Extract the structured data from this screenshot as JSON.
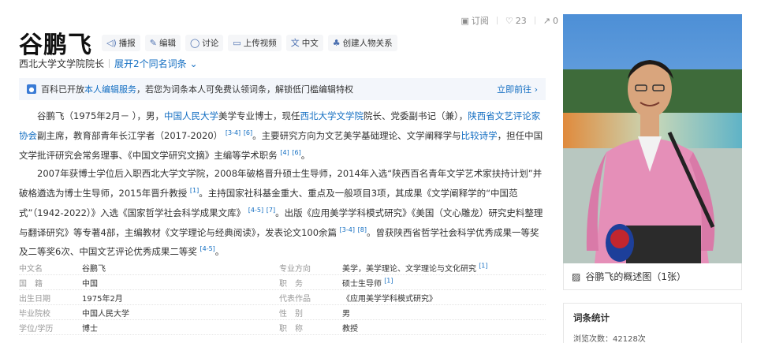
{
  "top_actions": {
    "subscribe": "订阅",
    "likes": "23",
    "shares": "0"
  },
  "title": "谷鹏飞",
  "tools": [
    "播报",
    "编辑",
    "讨论",
    "上传视频",
    "中文",
    "创建人物关系"
  ],
  "subtitle": {
    "desc": "西北大学文学院院长",
    "expand": "展开2个同名词条"
  },
  "notice": {
    "prefix": "百科已开放",
    "link": "本人编辑服务",
    "suffix": "，若您为词条本人可免费认领词条，解锁低门槛编辑特权",
    "go": "立即前往"
  },
  "para1": {
    "s1": "谷鹏飞（1975年2月－ ），男，",
    "l1": "中国人民大学",
    "s2": "美学专业博士，现任",
    "l2": "西北大学文学院",
    "s3": "院长、党委副书记（兼），",
    "l3": "陕西省文艺评论家协会",
    "s4": "副主席，教育部青年长江学者（2017-2020）",
    "r1": "[3-4]",
    "r2": "[6]",
    "s5": "。主要研究方向为文艺美学基础理论、文学阐释学与",
    "l4": "比较诗学",
    "s6": "，担任中国文学批评研究会常务理事、《中国文学研究文摘》主编等学术职务",
    "r3": "[4]",
    "r4": "[6]",
    "s7": "。"
  },
  "para2": {
    "s1": "2007年获博士学位后入职西北大学文学院，2008年破格晋升硕士生导师，2014年入选“陕西百名青年文学艺术家扶持计划”并破格遴选为博士生导师，2015年晋升教授",
    "r1": "[1]",
    "s2": "。主持国家社科基金重大、重点及一般项目3项，其成果《文学阐释学的“中国范式”（1942-2022）》入选《国家哲学社会科学成果文库》",
    "r2": "[4-5]",
    "r3": "[7]",
    "s3": "。出版《应用美学学科模式研究》《美国（文心雕龙）研究史料整理与翻译研究》等专著4部，主编教材《文学理论与经典阅读》，发表论文100余篇",
    "r4": "[3-4]",
    "r5": "[8]",
    "s4": "。曾获陕西省哲学社会科学优秀成果一等奖及二等奖6次、中国文艺评论优秀成果二等奖",
    "r6": "[4-5]",
    "s5": "。"
  },
  "info": [
    {
      "k1": "中文名",
      "v1": "谷鹏飞",
      "k2": "专业方向",
      "v2": "美学，美学理论、文学理论与文化研究",
      "ref": "[1]"
    },
    {
      "k1": "国　籍",
      "v1": "中国",
      "link1": true,
      "k2": "职　务",
      "v2": "硕士生导师",
      "ref": "[1]"
    },
    {
      "k1": "出生日期",
      "v1": "1975年2月",
      "k2": "代表作品",
      "v2": "《应用美学学科模式研究》",
      "ref": ""
    },
    {
      "k1": "毕业院校",
      "v1": "中国人民大学",
      "link1": true,
      "k2": "性　别",
      "v2": "男",
      "ref": ""
    },
    {
      "k1": "学位/学历",
      "v1": "博士",
      "k2": "职　称",
      "v2": "教授",
      "ref": ""
    }
  ],
  "side": {
    "caption": "谷鹏飞的概述图（1张）",
    "stats_title": "词条统计",
    "views": "浏览次数：42128次"
  },
  "colors": {
    "link": "#136ec2",
    "notice_bg": "#f3f6fb",
    "shirt": "#e58fb8"
  }
}
